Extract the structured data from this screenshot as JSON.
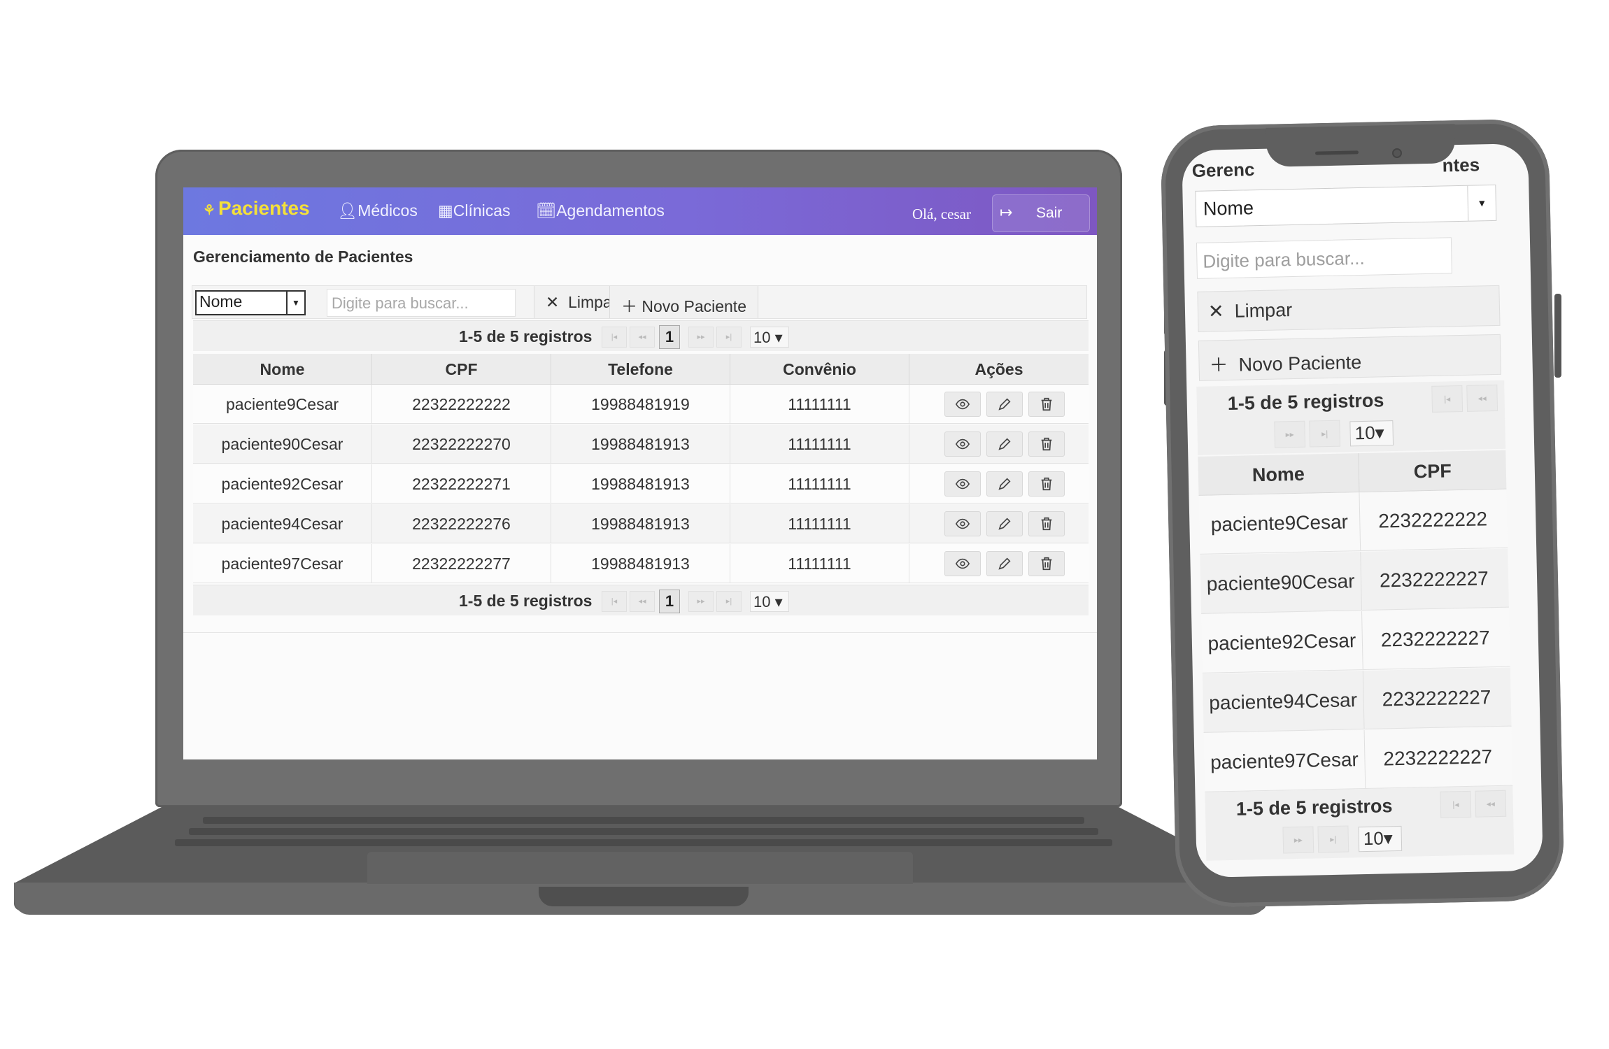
{
  "laptop": {
    "navbar": {
      "brand": "Pacientes",
      "links": [
        "Médicos",
        "Clínicas",
        "Agendamentos"
      ],
      "greeting": "Olá, cesar",
      "logout": "Sair"
    },
    "page_title": "Gerenciamento de Pacientes",
    "toolbar": {
      "filter_value": "Nome",
      "search_placeholder": "Digite para buscar...",
      "clear": "Limpar",
      "new": "Novo Paciente"
    },
    "pager": {
      "summary": "1-5 de 5 registros",
      "current_page": "1",
      "page_size": "10"
    },
    "columns": [
      "Nome",
      "CPF",
      "Telefone",
      "Convênio",
      "Ações"
    ],
    "rows": [
      {
        "nome": "paciente9Cesar",
        "cpf": "22322222222",
        "telefone": "19988481919",
        "convenio": "11111111"
      },
      {
        "nome": "paciente90Cesar",
        "cpf": "22322222270",
        "telefone": "19988481913",
        "convenio": "11111111"
      },
      {
        "nome": "paciente92Cesar",
        "cpf": "22322222271",
        "telefone": "19988481913",
        "convenio": "11111111"
      },
      {
        "nome": "paciente94Cesar",
        "cpf": "22322222276",
        "telefone": "19988481913",
        "convenio": "11111111"
      },
      {
        "nome": "paciente97Cesar",
        "cpf": "22322222277",
        "telefone": "19988481913",
        "convenio": "11111111"
      }
    ]
  },
  "phone": {
    "title_left": "Gerenc",
    "title_right": "ntes",
    "filter_value": "Nome",
    "search_placeholder": "Digite para buscar...",
    "clear": "Limpar",
    "new": "Novo Paciente",
    "pager": {
      "summary": "1-5 de 5 registros",
      "page_size": "10"
    },
    "columns": [
      "Nome",
      "CPF"
    ],
    "rows": [
      {
        "nome": "paciente9Cesar",
        "cpf": "2232222222"
      },
      {
        "nome": "paciente90Cesar",
        "cpf": "2232222227"
      },
      {
        "nome": "paciente92Cesar",
        "cpf": "2232222227"
      },
      {
        "nome": "paciente94Cesar",
        "cpf": "2232222227"
      },
      {
        "nome": "paciente97Cesar",
        "cpf": "2232222227"
      }
    ]
  },
  "colors": {
    "navbar_start": "#6d78e0",
    "navbar_end": "#7e57c2",
    "brand": "#f4e03a"
  },
  "icons": [
    "users-icon",
    "user-icon",
    "building-icon",
    "calendar-icon",
    "logout-icon",
    "close-icon",
    "plus-icon",
    "eye-icon",
    "pencil-icon",
    "trash-icon",
    "first-page-icon",
    "prev-page-icon",
    "next-page-icon",
    "last-page-icon"
  ]
}
